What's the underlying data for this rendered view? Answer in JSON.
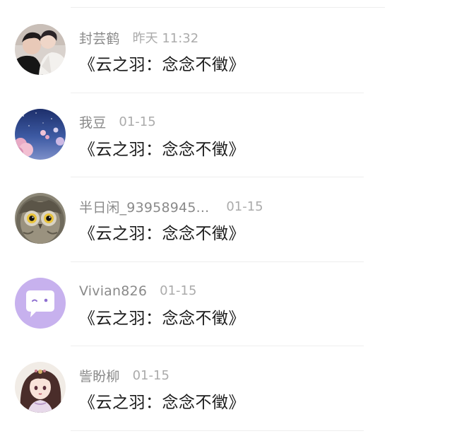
{
  "messages": [
    {
      "name": "封芸鹤",
      "time": "昨天 11:32",
      "text": "《云之羽：念念不徵》",
      "avatar": "couple-photo-avatar"
    },
    {
      "name": "我豆",
      "time": "01-15",
      "text": "《云之羽：念念不徵》",
      "avatar": "sky-blossom-avatar"
    },
    {
      "name": "半日闲_93958945...",
      "time": "01-15",
      "text": "《云之羽：念念不徵》",
      "avatar": "owl-avatar"
    },
    {
      "name": "Vivian826",
      "time": "01-15",
      "text": "《云之羽：念念不徵》",
      "avatar": "chat-bubble-face-avatar"
    },
    {
      "name": "訾盼柳",
      "time": "01-15",
      "text": "《云之羽：念念不徵》",
      "avatar": "anime-girl-avatar"
    }
  ],
  "colors": {
    "name": "#8a8a8a",
    "time": "#ababab",
    "message": "#1c1c1c",
    "divider": "#eeeeee",
    "lavender_avatar": "#c7b1ee"
  }
}
